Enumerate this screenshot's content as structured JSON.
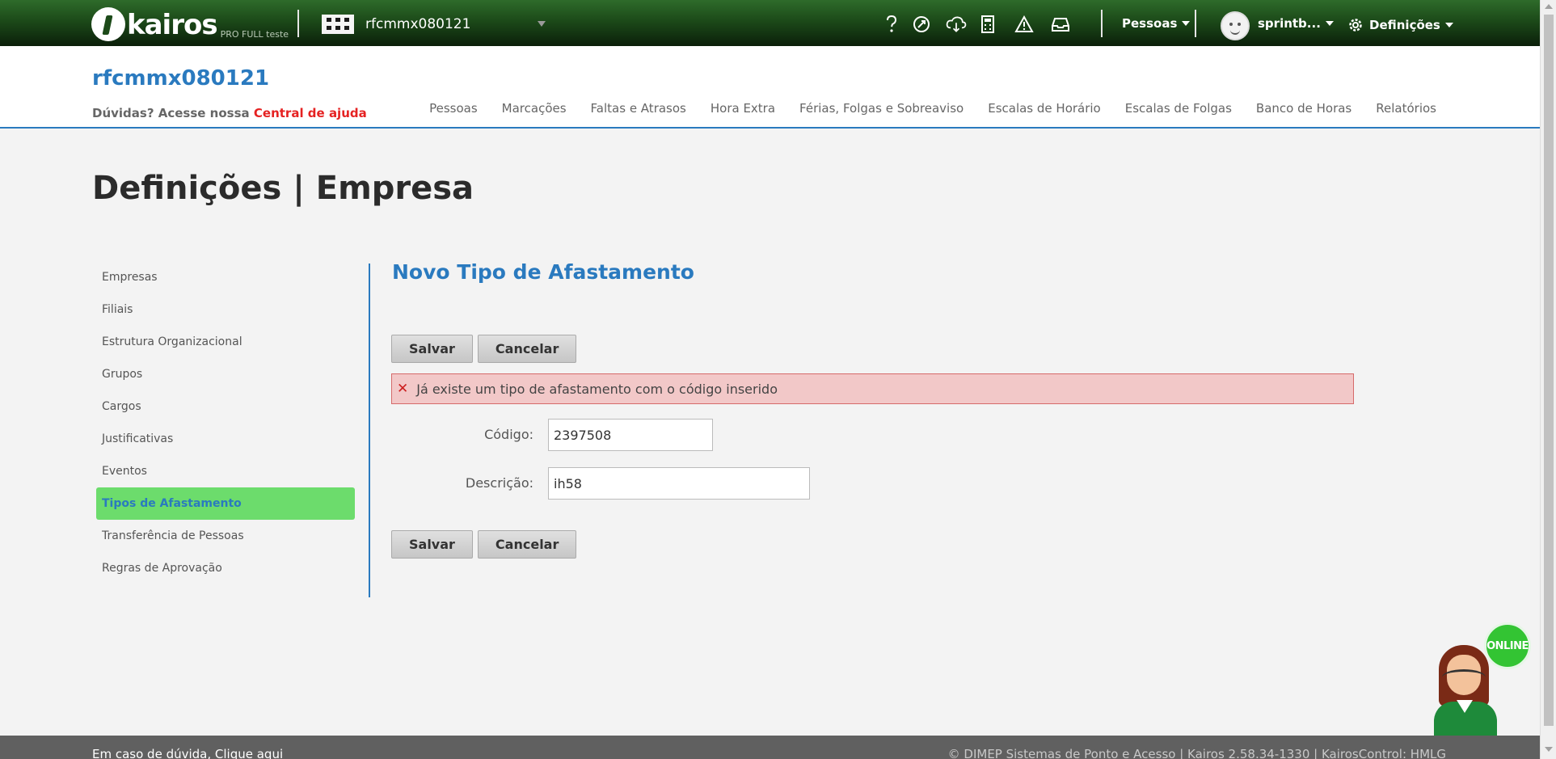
{
  "topbar": {
    "logo_text": "kairos",
    "logo_subtitle": "PRO FULL teste",
    "company": "rfcmmx080121",
    "icons": [
      "help-icon",
      "rocket-icon",
      "cloud-download-icon",
      "calculator-icon",
      "warning-icon",
      "inbox-icon"
    ],
    "people_menu": "Pessoas",
    "user_name": "sprintb...",
    "settings_menu": "Definições"
  },
  "header": {
    "title": "rfcmmx080121",
    "help_prefix": "Dúvidas? Acesse nossa",
    "help_link": "Central de ajuda",
    "nav": [
      "Pessoas",
      "Marcações",
      "Faltas e Atrasos",
      "Hora Extra",
      "Férias, Folgas e Sobreaviso",
      "Escalas de Horário",
      "Escalas de Folgas",
      "Banco de Horas",
      "Relatórios"
    ]
  },
  "page": {
    "title": "Definições | Empresa"
  },
  "sidebar": {
    "items": [
      "Empresas",
      "Filiais",
      "Estrutura Organizacional",
      "Grupos",
      "Cargos",
      "Justificativas",
      "Eventos",
      "Tipos de Afastamento",
      "Transferência de Pessoas",
      "Regras de Aprovação"
    ],
    "active_index": 7
  },
  "form": {
    "title": "Novo Tipo de Afastamento",
    "save_label": "Salvar",
    "cancel_label": "Cancelar",
    "error_message": "Já existe um tipo de afastamento com o código inserido",
    "code_label": "Código:",
    "code_value": "2397508",
    "description_label": "Descrição:",
    "description_value": "ih58"
  },
  "chat": {
    "status": "ONLINE"
  },
  "footer": {
    "left": "Em caso de dúvida, Clique aqui",
    "right": "© DIMEP Sistemas de Ponto e Acesso | Kairos 2.58.34-1330 | KairosControl: HMLG"
  },
  "colors": {
    "accent": "#2a7abf",
    "active_item": "#6cdc6c",
    "error_bg": "#f2c8c8",
    "help_link": "#e52222"
  }
}
